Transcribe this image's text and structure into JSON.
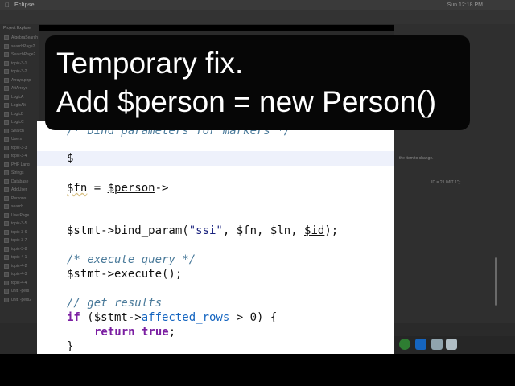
{
  "menubar": {
    "app": "Eclipse",
    "clock": "Sun 12:18 PM"
  },
  "explorer": {
    "title": "Project Explorer",
    "items": [
      "AlgebraSearch",
      "searchPage2",
      "SearchPage2",
      "topic-3-1",
      "topic-3-2",
      "Arrays.php",
      "AltArrays",
      "LogicA",
      "LogicAlt",
      "LogicB",
      "LogicC",
      "Search",
      "Users",
      "topic-3-3",
      "topic-3-4",
      "PHP Lang",
      "Strings",
      "Database",
      "AddUser",
      "Persons",
      "search",
      "UserPage",
      "topic-3-5",
      "topic-3-6",
      "topic-3-7",
      "topic-3-8",
      "topic-4-1",
      "topic-4-2",
      "topic-4-3",
      "topic-4-4",
      "unit7-pers",
      "unit7-pers2"
    ]
  },
  "right_pane": {
    "hint1": "the item to change.",
    "hint2": "ID = ? LIMIT 1\");"
  },
  "caption": {
    "line1": "Temporary fix.",
    "line2": "Add $person = new Person()"
  },
  "code": {
    "comment_bind": "/* bind parameters for markers */",
    "line_cursor": "$",
    "fn_var": "$fn",
    "fn_eq": " = ",
    "person_var": "$person",
    "arrow": "->",
    "stmt_bind": "$stmt->bind_param(",
    "bind_str": "\"ssi\"",
    "bind_args1": ", ",
    "bind_fn": "$fn",
    "bind_args2": ", ",
    "bind_ln": "$ln",
    "bind_args3": ", ",
    "bind_id": "$id",
    "bind_end": ");",
    "comment_exec": "/* execute query */",
    "exec": "$stmt->execute();",
    "comment_results": "// get results",
    "if_kw": "if",
    "if_open": " ($stmt->",
    "affected": "affected_rows",
    "if_close": " > 0) {",
    "return_kw": "return",
    "true_kw": "true",
    "semicolon": ";",
    "close_brace": "}"
  }
}
